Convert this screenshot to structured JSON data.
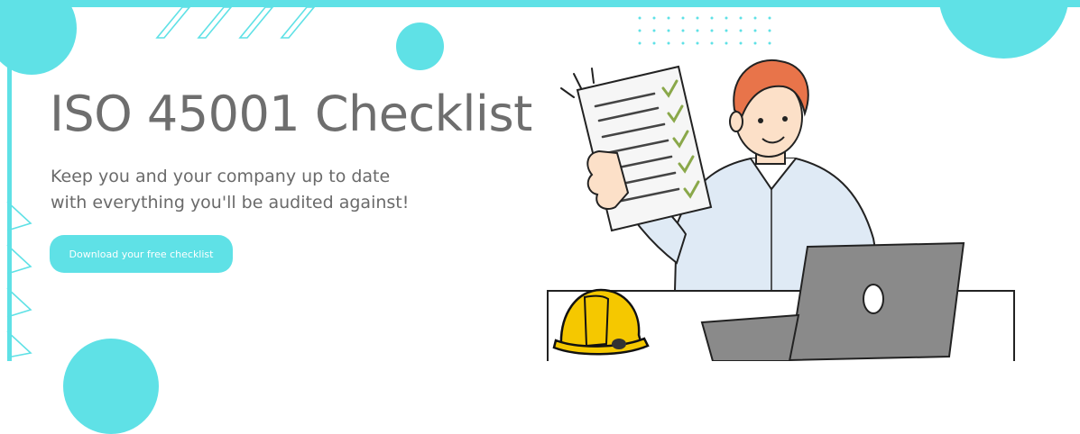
{
  "hero": {
    "title": "ISO 45001 Checklist",
    "subtitle_line1": "Keep you and your company up to date",
    "subtitle_line2": "with everything you'll be audited against!",
    "cta_label": "Download your free checklist"
  },
  "colors": {
    "accent": "#5fe1e6",
    "title_text": "#6e6e6e",
    "body_text": "#6a6a6a",
    "button_text": "#ffffff",
    "helmet": "#f5c800",
    "check": "#8aa84a",
    "shirt": "#dfeaf5",
    "hair": "#e8744a",
    "laptop": "#8a8a8a"
  },
  "illustration": {
    "subject": "person-holding-checklist-with-laptop",
    "icons": [
      "checklist-icon",
      "hard-hat-icon",
      "laptop-icon"
    ]
  }
}
